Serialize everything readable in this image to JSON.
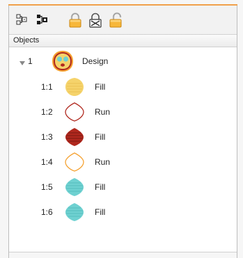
{
  "toolbar": {
    "buttons": [
      {
        "name": "ungroup-objects-icon"
      },
      {
        "name": "group-objects-icon"
      },
      {
        "name": "lock-icon"
      },
      {
        "name": "lock-disabled-icon"
      },
      {
        "name": "unlock-icon"
      }
    ]
  },
  "panel": {
    "header": "Objects",
    "design": {
      "index": "1",
      "label": "Design"
    },
    "items": [
      {
        "index": "1:1",
        "label": "Fill",
        "thumb": "yellow-fill",
        "color": "#f5d36b"
      },
      {
        "index": "1:2",
        "label": "Run",
        "thumb": "red-outline",
        "color": "#b0281e"
      },
      {
        "index": "1:3",
        "label": "Fill",
        "thumb": "red-fill",
        "color": "#b0281e"
      },
      {
        "index": "1:4",
        "label": "Run",
        "thumb": "orange-outline",
        "color": "#f5a130"
      },
      {
        "index": "1:5",
        "label": "Fill",
        "thumb": "cyan-fill",
        "color": "#6fd1d1"
      },
      {
        "index": "1:6",
        "label": "Fill",
        "thumb": "cyan-fill",
        "color": "#6fd1d1"
      }
    ]
  }
}
